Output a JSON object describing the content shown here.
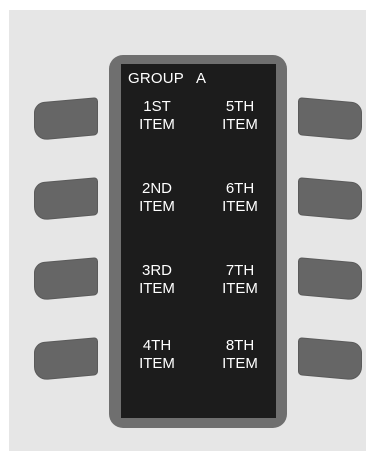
{
  "screen": {
    "title": "GROUP   A",
    "items": [
      {
        "line1": "1ST",
        "line2": "ITEM"
      },
      {
        "line1": "2ND",
        "line2": "ITEM"
      },
      {
        "line1": "3RD",
        "line2": "ITEM"
      },
      {
        "line1": "4TH",
        "line2": "ITEM"
      },
      {
        "line1": "5TH",
        "line2": "ITEM"
      },
      {
        "line1": "6TH",
        "line2": "ITEM"
      },
      {
        "line1": "7TH",
        "line2": "ITEM"
      },
      {
        "line1": "8TH",
        "line2": "ITEM"
      }
    ]
  },
  "colors": {
    "panel": "#e6e6e6",
    "bezel": "#6f6f6f",
    "screen": "#1c1c1c",
    "softkey": "#666666",
    "text": "#ffffff"
  }
}
